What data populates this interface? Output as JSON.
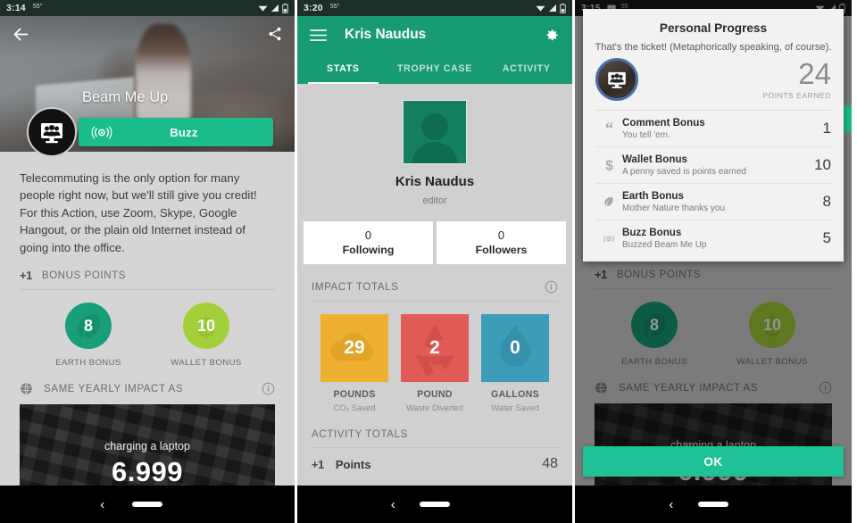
{
  "screen1": {
    "status": {
      "time": "3:14",
      "temp": "55°",
      "wifi_icon": "wifi-icon",
      "signal_icon": "signal-icon",
      "battery_icon": "battery-icon"
    },
    "topbar": {
      "back_icon": "back-arrow-icon",
      "share_icon": "share-icon"
    },
    "hero": {
      "title": "Beam Me Up",
      "badge_icon": "monitor-people-icon"
    },
    "buzz_button": {
      "label": "Buzz",
      "icon": "buzz-broadcast-icon"
    },
    "description": "Telecommuting is the only option for many people right now, but we'll still give you credit! For this Action, use Zoom, Skype, Google Hangout, or the plain old Internet instead of going into the office.",
    "bonus_points": {
      "prefix": "+1",
      "label": "BONUS POINTS"
    },
    "bonuses": [
      {
        "value": "8",
        "label": "EARTH BONUS",
        "color": "#189e78",
        "icon": "leaf-icon"
      },
      {
        "value": "10",
        "label": "WALLET BONUS",
        "color": "#a3cf3a",
        "icon": "dollar-icon"
      }
    ],
    "yearly_impact": {
      "label": "SAME YEARLY IMPACT AS",
      "globe_icon": "globe-icon",
      "info_icon": "info-icon"
    },
    "photo_card": {
      "caption": "charging a laptop",
      "value": "6.999"
    },
    "navbar": {
      "back_icon": "nav-back-icon",
      "home_pill": "home-pill"
    }
  },
  "screen2": {
    "status": {
      "time": "3:20",
      "temp": "55°"
    },
    "appbar": {
      "menu_icon": "hamburger-menu-icon",
      "title": "Kris Naudus",
      "settings_icon": "gear-icon"
    },
    "tabs": [
      {
        "label": "STATS",
        "active": true
      },
      {
        "label": "TROPHY CASE",
        "active": false
      },
      {
        "label": "ACTIVITY",
        "active": false
      }
    ],
    "profile": {
      "avatar_icon": "user-avatar-icon",
      "name": "Kris Naudus",
      "role": "editor"
    },
    "follow": [
      {
        "count": "0",
        "label": "Following"
      },
      {
        "count": "0",
        "label": "Followers"
      }
    ],
    "impact_totals": {
      "heading": "IMPACT TOTALS",
      "info_icon": "info-icon"
    },
    "tiles": [
      {
        "value": "29",
        "unit": "POUNDS",
        "sub": "CO₂ Saved",
        "color": "#eeb030",
        "icon": "cloud-icon"
      },
      {
        "value": "2",
        "unit": "POUND",
        "sub": "Waste Diverted",
        "color": "#e05b55",
        "icon": "recycle-icon"
      },
      {
        "value": "0",
        "unit": "GALLONS",
        "sub": "Water Saved",
        "color": "#3d9cb8",
        "icon": "water-drop-icon"
      }
    ],
    "activity_totals": {
      "heading": "ACTIVITY TOTALS"
    },
    "points": {
      "prefix": "+1",
      "label": "Points",
      "value": "48"
    }
  },
  "screen3": {
    "status": {
      "time": "3:15",
      "temp": "55",
      "photo_icon": "photo-icon"
    },
    "dialog": {
      "title": "Personal Progress",
      "subtitle": "That's the ticket! (Metaphorically speaking, of course).",
      "avatar_icon": "monitor-people-icon",
      "points_value": "24",
      "points_label": "POINTS EARNED",
      "items": [
        {
          "icon": "quote-icon",
          "title": "Comment Bonus",
          "sub": "You tell 'em.",
          "value": "1"
        },
        {
          "icon": "dollar-icon",
          "title": "Wallet Bonus",
          "sub": "A penny saved is points earned",
          "value": "10"
        },
        {
          "icon": "leaf-icon",
          "title": "Earth Bonus",
          "sub": "Mother Nature thanks you",
          "value": "8"
        },
        {
          "icon": "buzz-broadcast-icon",
          "title": "Buzz Bonus",
          "sub": "Buzzed Beam Me Up",
          "value": "5"
        }
      ]
    },
    "ok_button": {
      "label": "OK"
    },
    "background": {
      "bonus_points": {
        "prefix": "+1",
        "label": "BONUS POINTS"
      },
      "bonuses": [
        {
          "value": "8",
          "label": "EARTH BONUS",
          "color": "#189e78"
        },
        {
          "value": "10",
          "label": "WALLET BONUS",
          "color": "#a3cf3a"
        }
      ],
      "yearly_impact": {
        "label": "SAME YEARLY IMPACT AS"
      },
      "photo_card": {
        "caption": "charging a laptop",
        "value": "6.999"
      }
    }
  },
  "theme": {
    "accent": "#1abc8c",
    "appbar": "#169b73",
    "page_bg": "#d5d5d5"
  }
}
